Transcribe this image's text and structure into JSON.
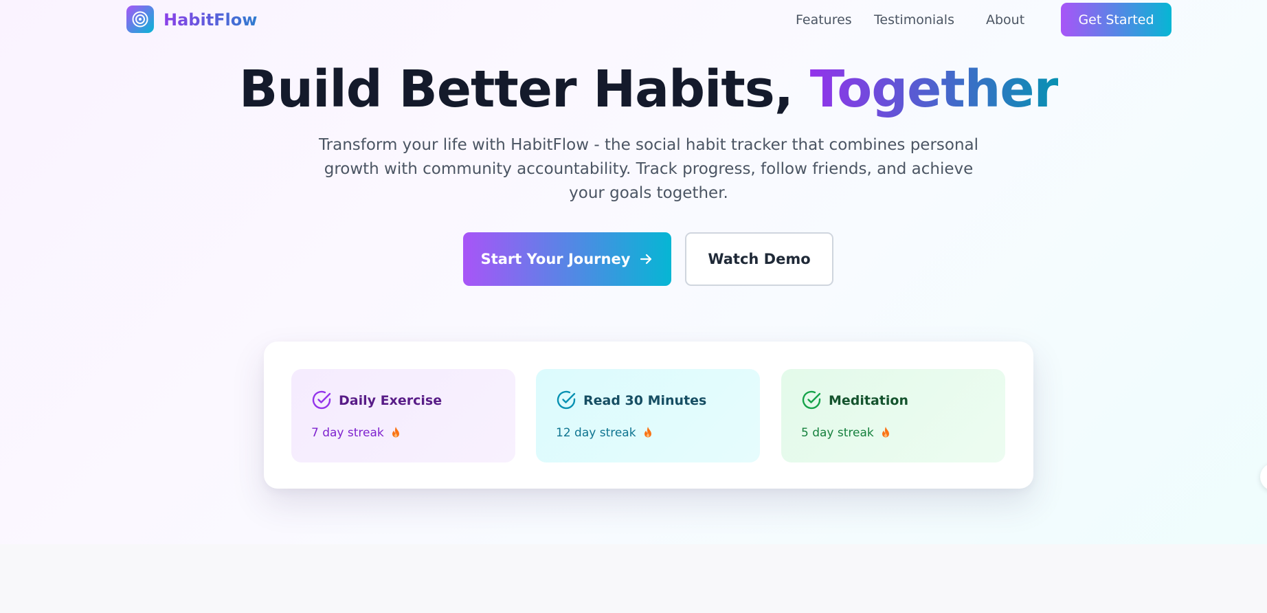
{
  "brand": {
    "name": "HabitFlow",
    "logo_icon": "target-icon",
    "gradient": [
      "#a855f7",
      "#06b6d4"
    ]
  },
  "nav": {
    "links": [
      "Features",
      "Testimonials",
      "About"
    ],
    "cta_label": "Get Started"
  },
  "hero": {
    "headline_main": "Build Better Habits,",
    "headline_accent": "Together",
    "subtitle": "Transform your life with HabitFlow - the social habit tracker that combines personal growth with community accountability. Track progress, follow friends, and achieve your goals together.",
    "primary_button": {
      "label": "Start Your Journey",
      "icon": "arrow-right-icon"
    },
    "secondary_button": {
      "label": "Watch Demo"
    }
  },
  "habits": [
    {
      "title": "Daily Exercise",
      "streak": "7 day streak",
      "icon": "check-circle-icon",
      "streak_icon": "fire-icon",
      "accent": "#9333ea",
      "title_color": "#581c87",
      "streak_color": "#7e22ce"
    },
    {
      "title": "Read 30 Minutes",
      "streak": "12 day streak",
      "icon": "check-circle-icon",
      "streak_icon": "fire-icon",
      "accent": "#0891b2",
      "title_color": "#164e63",
      "streak_color": "#0e7490"
    },
    {
      "title": "Meditation",
      "streak": "5 day streak",
      "icon": "check-circle-icon",
      "streak_icon": "fire-icon",
      "accent": "#16a34a",
      "title_color": "#14532d",
      "streak_color": "#15803d"
    }
  ]
}
